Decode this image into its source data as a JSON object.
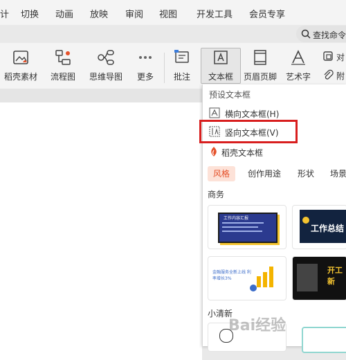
{
  "menu": {
    "items": [
      "计",
      "切换",
      "动画",
      "放映",
      "审阅",
      "视图",
      "开发工具",
      "会员专享"
    ],
    "search_label": "查找命令"
  },
  "toolbar": {
    "items": [
      {
        "label": "稻壳素材",
        "icon": "image-icon"
      },
      {
        "label": "流程图",
        "icon": "flowchart-icon"
      },
      {
        "label": "思维导图",
        "icon": "mindmap-icon"
      },
      {
        "label": "更多",
        "icon": "more-icon"
      },
      {
        "label": "批注",
        "icon": "comment-icon"
      },
      {
        "label": "文本框",
        "icon": "textbox-icon"
      },
      {
        "label": "页眉页脚",
        "icon": "header-footer-icon"
      },
      {
        "label": "艺术字",
        "icon": "art-text-icon"
      },
      {
        "label": "对",
        "icon": "object-icon"
      },
      {
        "label": "附",
        "icon": "attachment-icon"
      }
    ]
  },
  "dropdown": {
    "preset_title": "预设文本框",
    "horizontal": "横向文本框(H)",
    "vertical": "竖向文本框(V)",
    "docer_title": "稻壳文本框",
    "tabs": [
      "风格",
      "创作用途",
      "形状",
      "场景"
    ],
    "section_business": "商务",
    "section_fresh": "小清新",
    "cards": {
      "card1_title": "工作内容汇报",
      "card2_title": "工作总结",
      "card3_text": "金融服务全新上线 利率增长3%",
      "card4_text": "开工 新"
    }
  },
  "watermark": "Bai经验",
  "colors": {
    "accent": "#e5512a",
    "highlight": "#d81e1e",
    "tab_bg": "#fde2d8"
  }
}
